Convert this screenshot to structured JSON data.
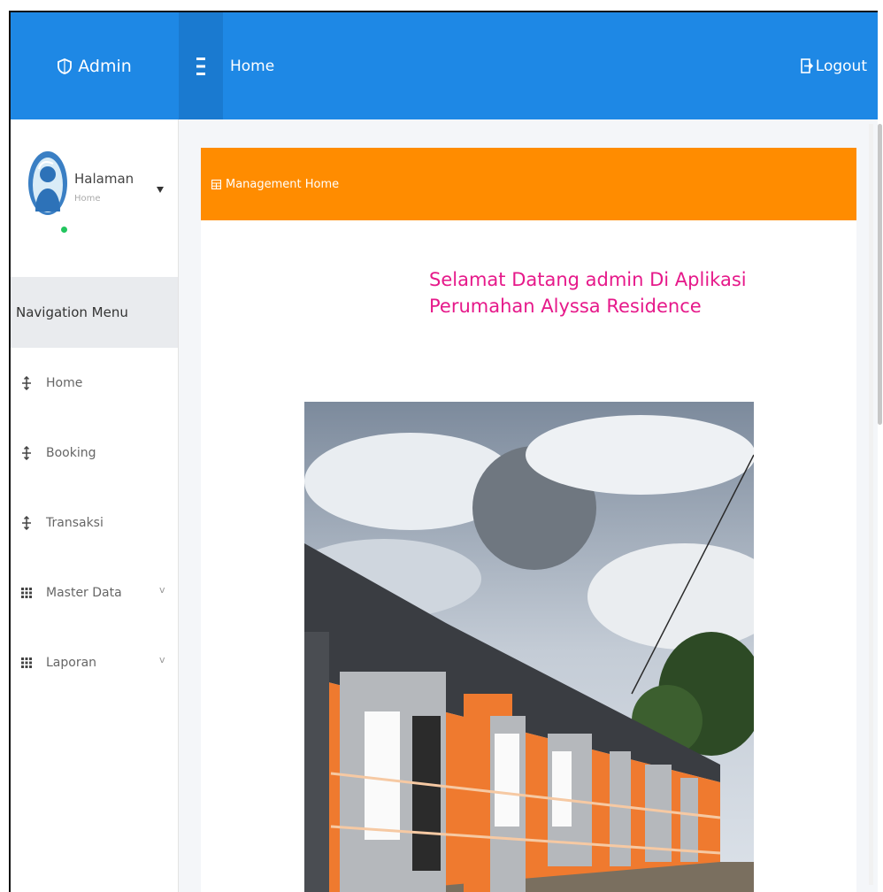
{
  "topbar": {
    "brand_label": "Admin",
    "brand_icon": "shield-icon",
    "title": "Home",
    "logout_label": "Logout",
    "logout_icon": "sign-out-icon",
    "color": "#1e88e5"
  },
  "user_panel": {
    "name": "Halaman",
    "role": "Home",
    "status": "online"
  },
  "sidebar": {
    "header": "Navigation Menu",
    "items": [
      {
        "label": "Home",
        "icon": "move-arrows-icon",
        "expandable": false
      },
      {
        "label": "Booking",
        "icon": "move-arrows-icon",
        "expandable": false
      },
      {
        "label": "Transaksi",
        "icon": "move-arrows-icon",
        "expandable": false
      },
      {
        "label": "Master Data",
        "icon": "grid-icon",
        "expandable": true
      },
      {
        "label": "Laporan",
        "icon": "grid-icon",
        "expandable": true
      }
    ],
    "chevron": "v"
  },
  "content": {
    "box_title": "Management Home",
    "box_icon": "table-icon",
    "box_color": "#ff8c00",
    "welcome_line1": "Selamat Datang admin Di Aplikasi",
    "welcome_line2": "Perumahan Alyssa Residence",
    "welcome_color": "#e6198a",
    "image": "photo of a row of orange one-story houses with grey roofs under a cloudy sky"
  }
}
